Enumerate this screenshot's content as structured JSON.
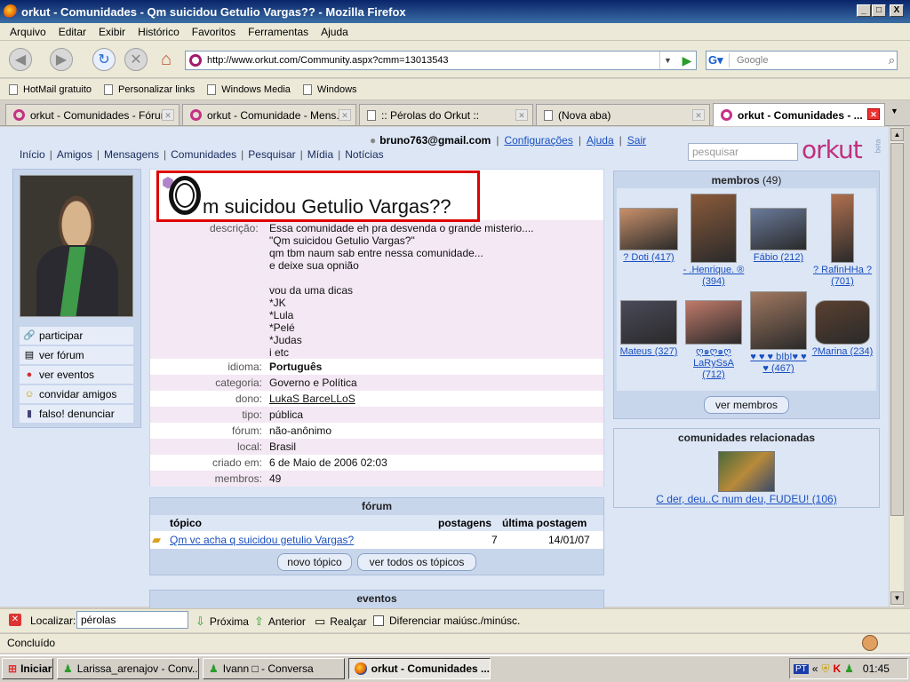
{
  "window": {
    "title": "orkut - Comunidades - Qm suicidou Getulio Vargas?? - Mozilla Firefox",
    "min": "_",
    "max": "□",
    "close": "X"
  },
  "menu": [
    "Arquivo",
    "Editar",
    "Exibir",
    "Histórico",
    "Favoritos",
    "Ferramentas",
    "Ajuda"
  ],
  "nav": {
    "url": "http://www.orkut.com/Community.aspx?cmm=13013543",
    "search_placeholder": "Google"
  },
  "bookmarks": [
    "HotMail gratuito",
    "Personalizar links",
    "Windows Media",
    "Windows"
  ],
  "tabs": [
    {
      "label": "orkut - Comunidades - Fórum",
      "icon": "orkut"
    },
    {
      "label": "orkut - Comunidade - Mens...",
      "icon": "orkut"
    },
    {
      "label": ":: Pérolas do Orkut ::",
      "icon": "page"
    },
    {
      "label": "(Nova aba)",
      "icon": "page"
    },
    {
      "label": "orkut - Comunidades - ...",
      "icon": "orkut",
      "active": true
    }
  ],
  "orkut": {
    "user_email": "bruno763@gmail.com",
    "links": [
      "Configurações",
      "Ajuda",
      "Sair"
    ],
    "topnav": [
      "Início",
      "Amigos",
      "Mensagens",
      "Comunidades",
      "Pesquisar",
      "Mídia",
      "Notícias"
    ],
    "search_placeholder": "pesquisar",
    "logo": "orkut",
    "beta": "beta"
  },
  "left_menu": [
    {
      "label": "participar",
      "icon": "link-icon"
    },
    {
      "label": "ver fórum",
      "icon": "forum-icon"
    },
    {
      "label": "ver eventos",
      "icon": "balloons-icon"
    },
    {
      "label": "convidar amigos",
      "icon": "invite-icon"
    },
    {
      "label": "falso! denunciar",
      "icon": "report-icon"
    }
  ],
  "community": {
    "title": "m suicidou Getulio Vargas??",
    "description_label": "descrição:",
    "description": "Essa comunidade eh pra desvenda o grande misterio....\n\"Qm suicidou Getulio Vargas?\"\nqm tbm naum sab entre nessa comunidade...\ne deixe sua opnião\n\nvou da uma dicas\n*JK\n*Lula\n*Pelé\n*Judas\ni etc",
    "fields": [
      {
        "label": "idioma:",
        "value": "Português",
        "bold": true
      },
      {
        "label": "categoria:",
        "value": "Governo e Política"
      },
      {
        "label": "dono:",
        "value": "LukaS BarceLLoS",
        "link": true
      },
      {
        "label": "tipo:",
        "value": "pública"
      },
      {
        "label": "fórum:",
        "value": "não-anônimo"
      },
      {
        "label": "local:",
        "value": "Brasil"
      },
      {
        "label": "criado em:",
        "value": "6 de Maio de 2006 02:03"
      },
      {
        "label": "membros:",
        "value": "49"
      }
    ]
  },
  "forum": {
    "title": "fórum",
    "headers": {
      "topic": "tópico",
      "posts": "postagens",
      "last": "última postagem"
    },
    "rows": [
      {
        "topic": "Qm vc acha q suicidou getulio Vargas?",
        "posts": "7",
        "last": "14/01/07"
      }
    ],
    "new_topic": "novo tópico",
    "all_topics": "ver todos os tópicos"
  },
  "events": {
    "title": "eventos"
  },
  "members": {
    "title": "membros",
    "count": "(49)",
    "list": [
      {
        "name": "? Doti (417)",
        "color": "#c8906a"
      },
      {
        "name": "- .Henrique. ® (394)",
        "color": "#8a5a3a"
      },
      {
        "name": "Fábio (212)",
        "color": "#6a7a9a"
      },
      {
        "name": "? RafinHHa ? (701)",
        "color": "#b07050"
      },
      {
        "name": "Mateus (327)",
        "color": "#4a4a5a"
      },
      {
        "name": "ღ๑ღ๑ღ LaRySsA (712)",
        "color": "#c07a6a"
      },
      {
        "name": "♥ ♥ ♥ bIbI♥ ♥ ♥ (467)",
        "color": "#a07860"
      },
      {
        "name": "?Marina (234)",
        "color": "#5a4030"
      }
    ],
    "see_all": "ver membros"
  },
  "related": {
    "title": "comunidades relacionadas",
    "items": [
      {
        "name": "C der, deu..C num deu, FUDEU! (106)"
      }
    ]
  },
  "findbar": {
    "label": "Localizar:",
    "value": "pérolas",
    "next": "Próxima",
    "prev": "Anterior",
    "highlight": "Realçar",
    "matchcase": "Diferenciar maiúsc./minúsc."
  },
  "status": "Concluído",
  "taskbar": {
    "start": "Iniciar",
    "items": [
      "Larissa_arenajov - Conv...",
      "Ivann  □ - Conversa",
      "orkut - Comunidades ..."
    ],
    "clock": "01:45",
    "lang": "PT"
  }
}
